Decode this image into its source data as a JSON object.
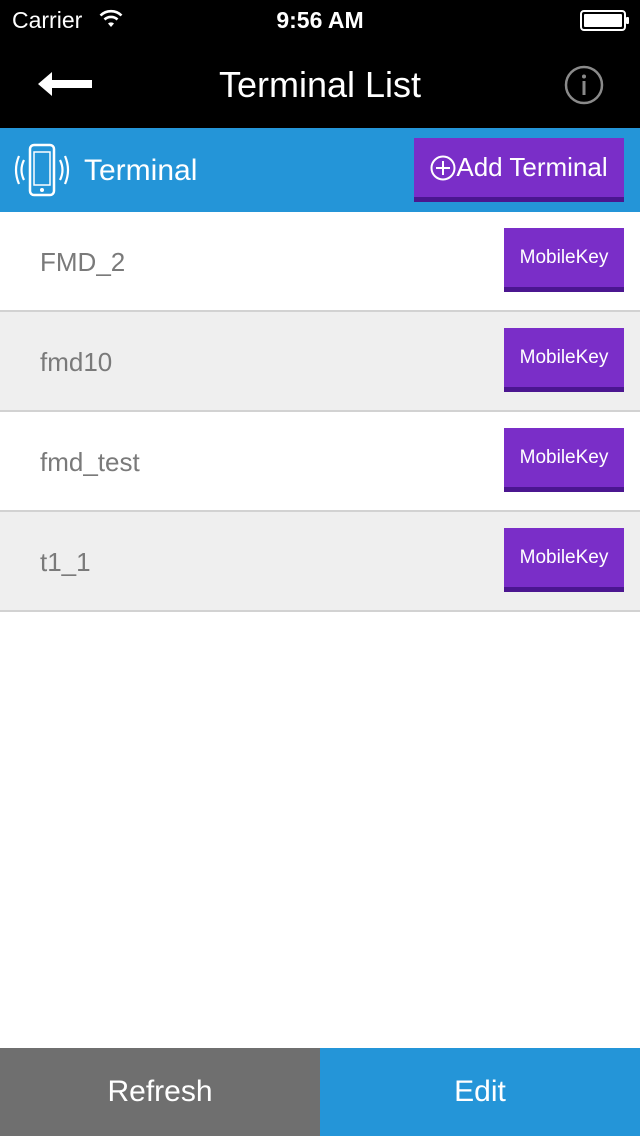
{
  "status_bar": {
    "carrier": "Carrier",
    "time": "9:56 AM"
  },
  "nav": {
    "title": "Terminal List",
    "back_icon": "back-arrow-icon",
    "info_icon": "info-icon"
  },
  "section": {
    "title": "Terminal",
    "icon": "vibrating-phone-icon",
    "add_button_label": "Add Terminal"
  },
  "terminals": [
    {
      "name": "FMD_2",
      "button_label": "MobileKey"
    },
    {
      "name": "fmd10",
      "button_label": "MobileKey"
    },
    {
      "name": "fmd_test",
      "button_label": "MobileKey"
    },
    {
      "name": "t1_1",
      "button_label": "MobileKey"
    }
  ],
  "bottom_bar": {
    "refresh_label": "Refresh",
    "edit_label": "Edit"
  },
  "colors": {
    "accent_blue": "#2495d8",
    "button_purple": "#7a2ec8",
    "nav_black": "#000000",
    "refresh_gray": "#6f6f6f"
  }
}
